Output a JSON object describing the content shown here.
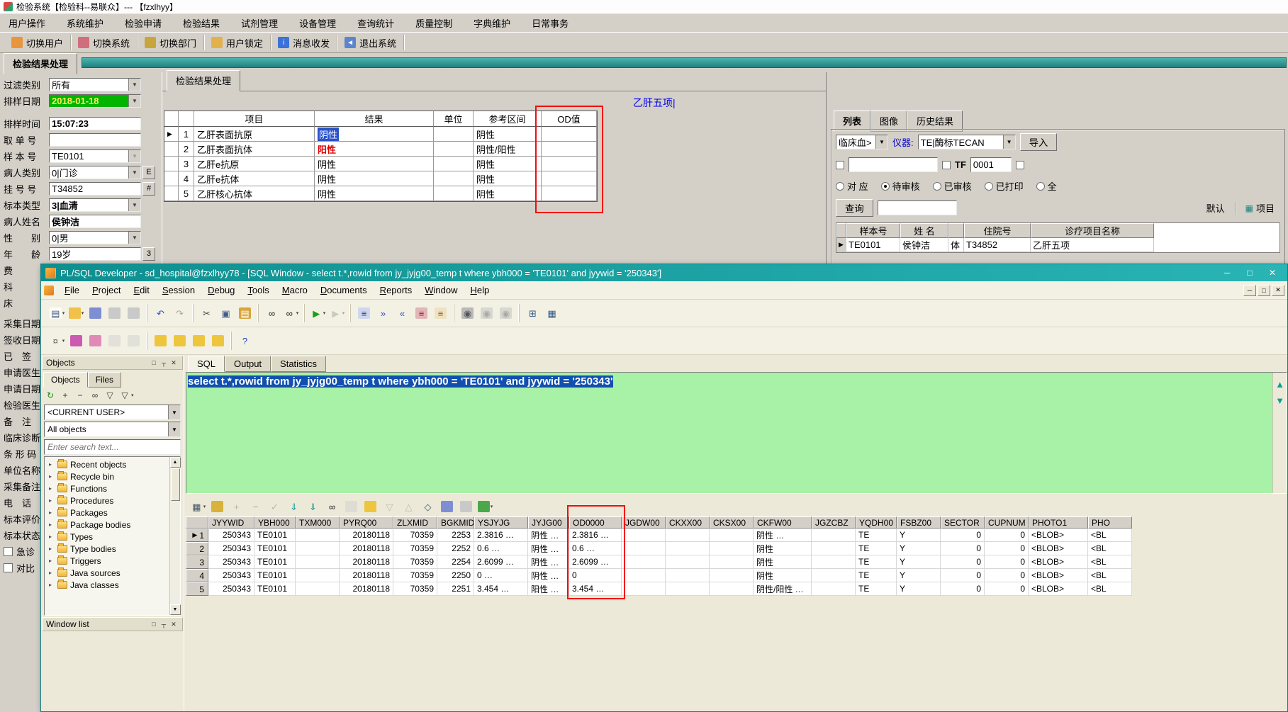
{
  "icons": {
    "dropdown": "▼",
    "dd_small": "▾",
    "row_indicator": "▶",
    "minimize": "─",
    "maximize": "□",
    "close": "✕",
    "pin": "┬",
    "up": "▲",
    "down": "▼",
    "tree_expand": "▸"
  },
  "lab": {
    "title": "检验系统【检验科--易联众】--- 【fzxlhyy】",
    "menu": [
      "用户操作",
      "系统维护",
      "检验申请",
      "检验结果",
      "试剂管理",
      "设备管理",
      "查询统计",
      "质量控制",
      "字典维护",
      "日常事务"
    ],
    "toolbar": [
      {
        "label": "切换用户",
        "n": "switch-user-icon",
        "c": "#e8953d"
      },
      {
        "label": "切换系统",
        "n": "switch-system-icon",
        "c": "#cf6f7c"
      },
      {
        "label": "切换部门",
        "n": "switch-department-icon",
        "c": "#c9a53e"
      },
      {
        "label": "用户锁定",
        "n": "user-lock-icon",
        "c": "#e3b04e"
      },
      {
        "label": "消息收发",
        "n": "message-icon",
        "c": "#3d72d8",
        "g": "i",
        "gc": "#ffffff"
      },
      {
        "label": "退出系统",
        "n": "exit-icon",
        "c": "#5d85cc",
        "g": "◄",
        "gc": "#ffffff"
      }
    ],
    "window_tab": "检验结果处理",
    "inner_tab": "检验结果处理",
    "blue_title": "乙肝五项|",
    "sidebar": {
      "rows": [
        {
          "label": "过滤类别",
          "value": "所有",
          "kind": "dropdown"
        },
        {
          "label": "排样日期",
          "value": "2018-01-18",
          "kind": "date"
        },
        {
          "label": "排样时间",
          "value": "15:07:23",
          "kind": "time gap"
        },
        {
          "label": "取 单 号",
          "value": "",
          "kind": "text"
        },
        {
          "label": "样 本 号",
          "value": "TE0101",
          "kind": "combo"
        },
        {
          "label": "病人类别",
          "value": "0|门诊",
          "kind": "dropdown",
          "suffix": "E"
        },
        {
          "label": "挂 号 号",
          "value": "T34852",
          "kind": "text",
          "suffix": "#"
        },
        {
          "label": "标本类型",
          "value": "3|血清",
          "kind": "dropdown em"
        },
        {
          "label": "病人姓名",
          "value": "侯钟洁",
          "kind": "text em"
        },
        {
          "label": "性　　别",
          "value": "0|男",
          "kind": "dropdown"
        },
        {
          "label": "年　　龄",
          "value": "19岁",
          "kind": "text",
          "suffix": "3"
        },
        {
          "label": "费",
          "value": "",
          "kind": "text"
        },
        {
          "label": "科",
          "value": "",
          "kind": "text"
        },
        {
          "label": "床",
          "value": "",
          "kind": "text"
        },
        {
          "label": "采集日期",
          "value": "",
          "kind": "text gap2"
        },
        {
          "label": "签收日期",
          "value": "",
          "kind": "text"
        },
        {
          "label": "已　签",
          "value": "",
          "kind": "text"
        },
        {
          "label": "申请医生",
          "value": "",
          "kind": "text"
        },
        {
          "label": "申请日期",
          "value": "",
          "kind": "text"
        },
        {
          "label": "检验医生",
          "value": "",
          "kind": "text"
        },
        {
          "label": "备　注",
          "value": "",
          "kind": "text"
        },
        {
          "label": "临床诊断",
          "value": "",
          "kind": "text"
        },
        {
          "label": "条 形 码",
          "value": "",
          "kind": "text"
        },
        {
          "label": "单位名称",
          "value": "",
          "kind": "text"
        },
        {
          "label": "采集备注",
          "value": "",
          "kind": "text"
        },
        {
          "label": "电　话",
          "value": "",
          "kind": "text"
        },
        {
          "label": "标本评价",
          "value": "",
          "kind": "text"
        },
        {
          "label": "标本状态",
          "value": "",
          "kind": "text"
        },
        {
          "label": "急诊",
          "value": "",
          "kind": "checkbox"
        },
        {
          "label": "对比",
          "value": "",
          "kind": "checkbox"
        }
      ]
    },
    "table": {
      "headers": [
        "",
        "",
        "项目",
        "结果",
        "单位",
        "参考区间",
        "OD值"
      ],
      "rows": [
        {
          "ind": "▶",
          "n": "1",
          "item": "乙肝表面抗原",
          "result": "阴性",
          "rcls": "sel",
          "unit": "",
          "ref": "阴性",
          "od": ""
        },
        {
          "ind": "",
          "n": "2",
          "item": "乙肝表面抗体",
          "result": "阳性",
          "rcls": "pos",
          "unit": "",
          "ref": "阴性/阳性",
          "od": ""
        },
        {
          "ind": "",
          "n": "3",
          "item": "乙肝e抗原",
          "result": "阴性",
          "rcls": "",
          "unit": "",
          "ref": "阴性",
          "od": ""
        },
        {
          "ind": "",
          "n": "4",
          "item": "乙肝e抗体",
          "result": "阴性",
          "rcls": "",
          "unit": "",
          "ref": "阴性",
          "od": ""
        },
        {
          "ind": "",
          "n": "5",
          "item": "乙肝核心抗体",
          "result": "阴性",
          "rcls": "",
          "unit": "",
          "ref": "阴性",
          "od": ""
        }
      ]
    },
    "right": {
      "tabs": [
        "列表",
        "图像",
        "历史结果"
      ],
      "dept": "临床血>",
      "inst_label": "仪器:",
      "inst": "TE|酶标TECAN",
      "import_btn": "导入",
      "tf_label": "TF",
      "tf_value": "0001",
      "radios": [
        {
          "label": "对 应",
          "on": ""
        },
        {
          "label": "待审核",
          "on": "on"
        },
        {
          "label": "已审核",
          "on": ""
        },
        {
          "label": "已打印",
          "on": ""
        },
        {
          "label": "全",
          "on": ""
        }
      ],
      "query_btn": "查询",
      "query_value": "",
      "default_btn": "默认",
      "item_btn": "项目",
      "item_btn_icon": "▦",
      "sample_headers": [
        "",
        "样本号",
        "姓 名",
        "",
        "住院号",
        "诊疗项目名称"
      ],
      "sample_row": {
        "ind": "▶",
        "c": [
          "TE0101",
          "侯钟洁",
          "体",
          "T34852",
          "乙肝五项"
        ]
      }
    }
  },
  "plsql": {
    "title": "PL/SQL Developer - sd_hospital@fzxlhyy78 - [SQL Window - select t.*,rowid from jy_jyjg00_temp t where ybh000 = 'TE0101' and jyywid = '250343']",
    "menu": [
      "File",
      "Project",
      "Edit",
      "Session",
      "Debug",
      "Tools",
      "Macro",
      "Documents",
      "Reports",
      "Window",
      "Help"
    ],
    "toolbar1": {
      "g1": [
        {
          "n": "new-file-icon",
          "c": "#fdfdf5",
          "g": "▤",
          "gc": "#445a8a",
          "dd": "▾"
        },
        {
          "n": "open-file-icon",
          "c": "#f2c14a",
          "dd": "▾"
        },
        {
          "n": "save-icon",
          "c": "#7d8fd2"
        },
        {
          "n": "print-icon",
          "c": "#c9c9c9"
        },
        {
          "n": "print-alt-icon",
          "c": "#c9c9c9"
        }
      ],
      "g2": [
        {
          "n": "undo-icon",
          "g": "↶",
          "gc": "#2a52c8"
        },
        {
          "n": "redo-icon",
          "g": "↷",
          "gc": "#2a52c8",
          "dis": "dis"
        }
      ],
      "g3": [
        {
          "n": "cut-icon",
          "g": "✂",
          "gc": "#444444"
        },
        {
          "n": "copy-icon",
          "g": "▣",
          "gc": "#445a8a"
        },
        {
          "n": "paste-icon",
          "c": "#d8a53a",
          "g": "▤",
          "gc": "#ffffff"
        }
      ],
      "g4": [
        {
          "n": "find-icon",
          "g": "∞",
          "gc": "#222222"
        },
        {
          "n": "find-next-icon",
          "g": "∞",
          "gc": "#222222",
          "dd": "▾"
        }
      ],
      "g5": [
        {
          "n": "execute-icon",
          "g": "▶",
          "gc": "#18a018",
          "dd": "▾"
        },
        {
          "n": "break-icon",
          "g": "▶",
          "gc": "#9a9a9a",
          "dis": "dis",
          "dd": "▾"
        }
      ],
      "g6": [
        {
          "n": "describe-icon",
          "c": "#cfd6ef",
          "g": "≡",
          "gc": "#334466"
        },
        {
          "n": "indent-icon",
          "g": "»",
          "gc": "#2a52c8"
        },
        {
          "n": "outdent-icon",
          "g": "«",
          "gc": "#2a52c8"
        },
        {
          "n": "compile-icon",
          "c": "#e2b6b6",
          "g": "≡",
          "gc": "#aa2222"
        },
        {
          "n": "export-file-icon",
          "c": "#efe2c2",
          "g": "≡",
          "gc": "#886633"
        }
      ],
      "g7": [
        {
          "n": "capture-icon",
          "c": "#b9b9b9",
          "g": "◉",
          "gc": "#555555"
        },
        {
          "n": "capture2-icon",
          "c": "#b9b9b9",
          "g": "◉",
          "gc": "#555555",
          "dis": "dis"
        },
        {
          "n": "capture3-icon",
          "c": "#b9b9b9",
          "g": "◉",
          "gc": "#555555",
          "dis": "dis"
        }
      ],
      "g8": [
        {
          "n": "window-cascade-icon",
          "g": "⊞",
          "gc": "#345a8a"
        },
        {
          "n": "window-tile-icon",
          "g": "▦",
          "gc": "#345a8a"
        }
      ]
    },
    "toolbar2": {
      "h1": [
        {
          "n": "preferences-icon",
          "g": "¤",
          "gc": "#666666",
          "dd": "▾"
        },
        {
          "n": "browser-filter-icon",
          "c": "#cc5ab0"
        },
        {
          "n": "format-icon",
          "c": "#e08ab8"
        },
        {
          "n": "lock-icon",
          "c": "#cccccc",
          "dis": "dis"
        },
        {
          "n": "unlock-icon",
          "c": "#cccccc",
          "dis": "dis"
        }
      ],
      "h2": [
        {
          "n": "commit-icon",
          "c": "#eec63e"
        },
        {
          "n": "rollback-icon",
          "c": "#eec63e"
        },
        {
          "n": "sessions-icon",
          "c": "#eec63e"
        },
        {
          "n": "sql-monitor-icon",
          "c": "#eec63e"
        }
      ],
      "h3": [
        {
          "n": "help-icon",
          "g": "?",
          "gc": "#1c3fbf"
        }
      ]
    },
    "objects": {
      "caption": "Objects",
      "tabs": [
        "Objects",
        "Files"
      ],
      "bar": [
        {
          "n": "refresh-icon",
          "g": "↻",
          "gc": "#18851a"
        },
        {
          "n": "add-folder-icon",
          "g": "+",
          "gc": "#333333"
        },
        {
          "n": "remove-folder-icon",
          "g": "−",
          "gc": "#333333"
        },
        {
          "n": "find-object-icon",
          "g": "∞",
          "gc": "#333333"
        },
        {
          "n": "filter-icon",
          "g": "▽",
          "gc": "#333333"
        },
        {
          "n": "filter-settings-icon",
          "g": "▽",
          "gc": "#333333",
          "dd": "▾"
        }
      ],
      "user_dd": "<CURRENT USER>",
      "filter_dd": "All objects",
      "search_placeholder": "Enter search text...",
      "tree": [
        "Recent objects",
        "Recycle bin",
        "Functions",
        "Procedures",
        "Packages",
        "Package bodies",
        "Types",
        "Type bodies",
        "Triggers",
        "Java sources",
        "Java classes"
      ],
      "window_list": "Window list"
    },
    "sql": {
      "tabs": [
        "SQL",
        "Output",
        "Statistics"
      ],
      "query": "select t.*,rowid from jy_jyjg00_temp t where ybh000 = 'TE0101' and jyywid = '250343'"
    },
    "gridbar": [
      {
        "n": "grid-mode-icon",
        "g": "▦",
        "gc": "#445566",
        "dd": "▾"
      },
      {
        "n": "lock-record-icon",
        "c": "#d8b23a"
      },
      {
        "n": "insert-record-icon",
        "g": "+",
        "gc": "#18a018",
        "dis": "dis"
      },
      {
        "n": "delete-record-icon",
        "g": "−",
        "gc": "#cc2222",
        "dis": "dis"
      },
      {
        "n": "post-record-icon",
        "g": "✓",
        "gc": "#18a018",
        "dis": "dis"
      },
      {
        "n": "fetch-next-icon",
        "g": "⇓",
        "gc": "#19a0a0"
      },
      {
        "n": "fetch-all-icon",
        "g": "⇓",
        "gc": "#19a0a0"
      },
      {
        "n": "find-record-icon",
        "g": "∞",
        "gc": "#222222"
      },
      {
        "n": "edit-record-icon",
        "c": "#cfcfcf",
        "dis": "dis"
      },
      {
        "n": "export-record-icon",
        "c": "#eec63e"
      },
      {
        "n": "sort-desc-icon",
        "g": "▽",
        "gc": "#19a0a0",
        "dis": "dis"
      },
      {
        "n": "sort-asc-icon",
        "g": "△",
        "gc": "#19a0a0",
        "dis": "dis"
      },
      {
        "n": "link-icon",
        "g": "◇",
        "gc": "#445566"
      },
      {
        "n": "save-grid-icon",
        "c": "#7d8fd2"
      },
      {
        "n": "print-grid-icon",
        "c": "#c9c9c9"
      },
      {
        "n": "chart-icon",
        "c": "#4aa84a",
        "dd": "▾"
      }
    ],
    "grid": {
      "headers": [
        "JYYWID",
        "YBH000",
        "TXM000",
        "PYRQ00",
        "ZLXMID",
        "BGKMID",
        "YSJYJG",
        "JYJG00",
        "OD0000",
        "JGDW00",
        "CKXX00",
        "CKSX00",
        "CKFW00",
        "JGZCBZ",
        "YQDH00",
        "FSBZ00",
        "SECTOR",
        "CUPNUM",
        "PHOTO1",
        "PHO"
      ],
      "rows": [
        {
          "ind": "▶",
          "n": "1",
          "c": [
            "250343",
            "TE0101",
            "",
            "20180118",
            "70359",
            "2253",
            "2.3816 …",
            "阴性 …",
            "2.3816 …",
            "",
            "",
            "",
            "阴性 …",
            "",
            "TE",
            "Y",
            "0",
            "0",
            "<BLOB>",
            "<BL"
          ]
        },
        {
          "ind": "",
          "n": "2",
          "c": [
            "250343",
            "TE0101",
            "",
            "20180118",
            "70359",
            "2252",
            "0.6 …",
            "阴性 …",
            "0.6 …",
            "",
            "",
            "",
            "阴性",
            "",
            "TE",
            "Y",
            "0",
            "0",
            "<BLOB>",
            "<BL"
          ]
        },
        {
          "ind": "",
          "n": "3",
          "c": [
            "250343",
            "TE0101",
            "",
            "20180118",
            "70359",
            "2254",
            "2.6099 …",
            "阴性 …",
            "2.6099 …",
            "",
            "",
            "",
            "阴性",
            "",
            "TE",
            "Y",
            "0",
            "0",
            "<BLOB>",
            "<BL"
          ]
        },
        {
          "ind": "",
          "n": "4",
          "c": [
            "250343",
            "TE0101",
            "",
            "20180118",
            "70359",
            "2250",
            "0 …",
            "阴性 …",
            "0",
            "",
            "",
            "",
            "阴性",
            "",
            "TE",
            "Y",
            "0",
            "0",
            "<BLOB>",
            "<BL"
          ]
        },
        {
          "ind": "",
          "n": "5",
          "c": [
            "250343",
            "TE0101",
            "",
            "20180118",
            "70359",
            "2251",
            "3.454 …",
            "阳性 …",
            "3.454 …",
            "",
            "",
            "",
            "阴性/阳性 …",
            "",
            "TE",
            "Y",
            "0",
            "0",
            "<BLOB>",
            "<BL"
          ]
        }
      ]
    }
  }
}
